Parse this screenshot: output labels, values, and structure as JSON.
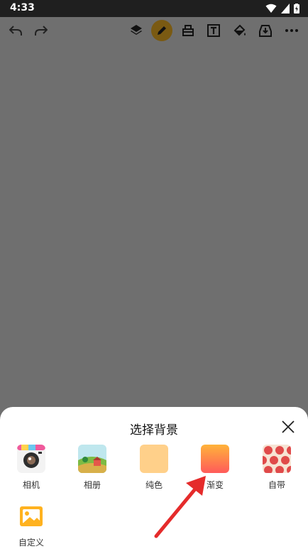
{
  "status_bar": {
    "time": "4:33"
  },
  "toolbar": {
    "items": [
      "undo-icon",
      "redo-icon",
      "layers-icon",
      "pencil-icon",
      "eraser-icon",
      "text-icon",
      "fill-bucket-icon",
      "save-icon",
      "more-icon"
    ]
  },
  "sheet": {
    "title": "选择背景",
    "options": [
      {
        "label": "相机"
      },
      {
        "label": "相册"
      },
      {
        "label": "纯色"
      },
      {
        "label": "渐变"
      },
      {
        "label": "自带"
      },
      {
        "label": "自定义"
      }
    ]
  },
  "colors": {
    "statusbar": "#1f1f1f",
    "canvas": "#6f6f6f",
    "active_tool_bg": "#7a5a12",
    "solid_color": "#ffd08a",
    "gradient_top": "#ffb33a",
    "gradient_bottom": "#ff5a5a",
    "arrow": "#e52b2b"
  }
}
